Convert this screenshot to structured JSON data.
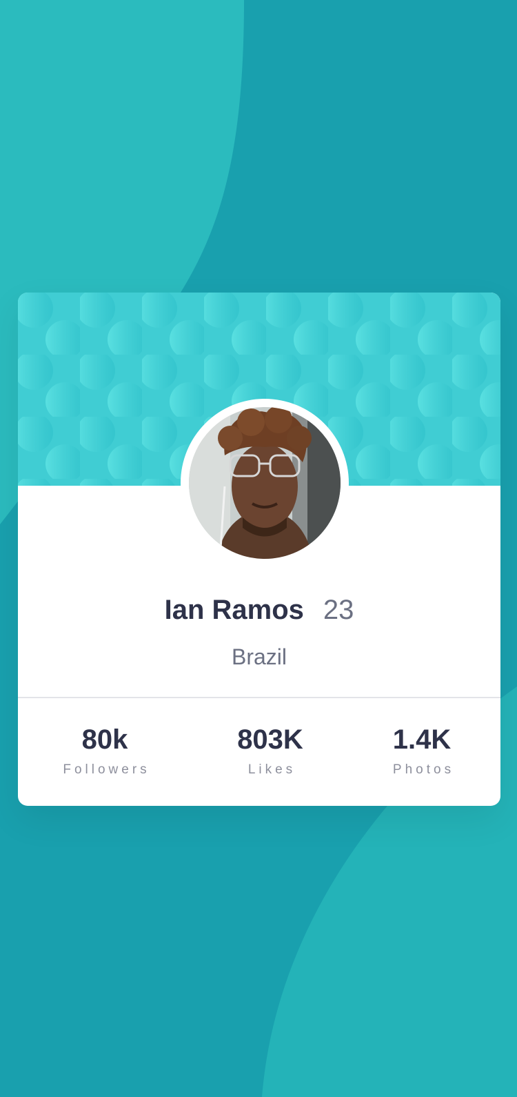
{
  "profile": {
    "name": "Ian Ramos",
    "age": "23",
    "country": "Brazil"
  },
  "stats": [
    {
      "value": "80k",
      "label": "Followers"
    },
    {
      "value": "803K",
      "label": "Likes"
    },
    {
      "value": "1.4K",
      "label": "Photos"
    }
  ],
  "colors": {
    "background": "#19a0ae",
    "background_accent": "#2bbbbe",
    "header_pattern": "#3fcfd4",
    "card": "#ffffff",
    "text_primary": "#2e3249",
    "text_secondary": "#6b7082",
    "text_muted": "#8d8f9c"
  }
}
